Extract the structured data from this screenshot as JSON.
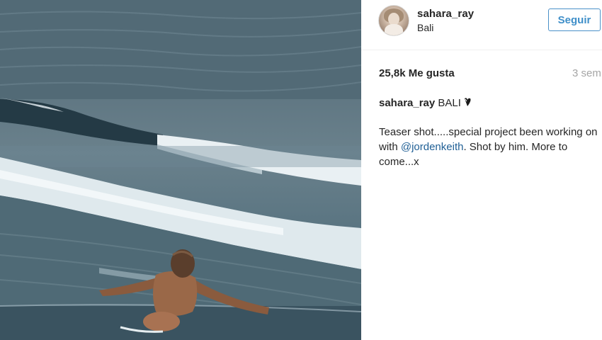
{
  "post": {
    "image_alt": "Woman in infinity pool looking at ocean waves"
  },
  "header": {
    "username": "sahara_ray",
    "location": "Bali",
    "follow_label": "Seguir"
  },
  "stats": {
    "likes": "25,8k Me gusta",
    "time_ago": "3 sem"
  },
  "caption": {
    "username": "sahara_ray",
    "text": "BALI",
    "emoji": "heart-icon"
  },
  "comment": {
    "part1": "Teaser shot.....special project been working on with ",
    "mention": "@jordenkeith",
    "part2": ". Shot by him. More to come...x"
  },
  "colors": {
    "follow_blue": "#3f8fc9",
    "mention_blue": "#1f5f95",
    "muted_gray": "#a5a5a5"
  }
}
